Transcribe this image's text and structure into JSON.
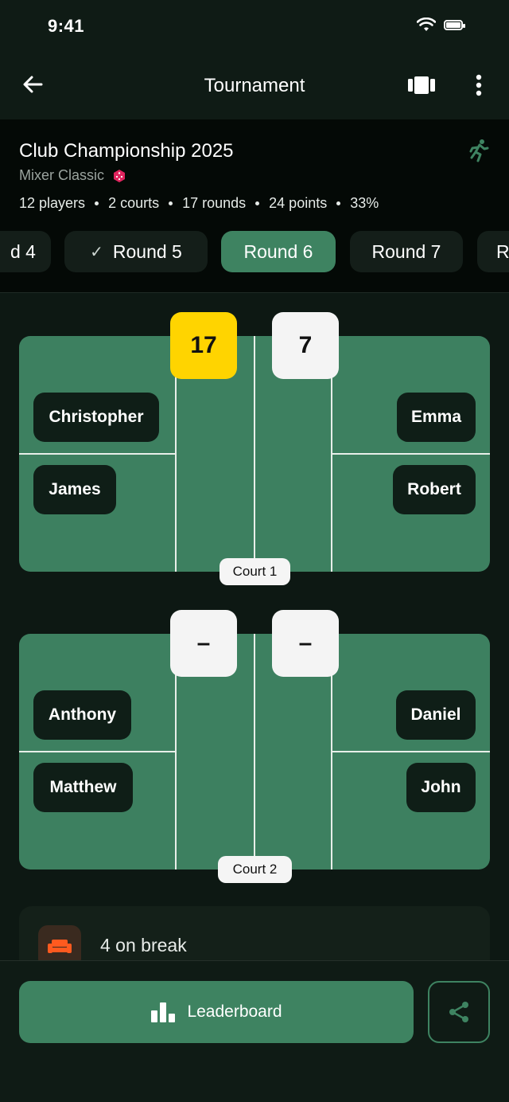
{
  "status": {
    "time": "9:41"
  },
  "nav": {
    "title": "Tournament"
  },
  "tournament": {
    "title": "Club Championship 2025",
    "format": "Mixer Classic",
    "stats": [
      "12 players",
      "2 courts",
      "17 rounds",
      "24 points",
      "33%"
    ]
  },
  "rounds": [
    {
      "label": "d 4",
      "state": "done"
    },
    {
      "label": "Round 5",
      "state": "done",
      "check": "✓"
    },
    {
      "label": "Round 6",
      "state": "active"
    },
    {
      "label": "Round 7",
      "state": "upcoming"
    },
    {
      "label": "R",
      "state": "upcoming"
    }
  ],
  "courts": [
    {
      "label": "Court 1",
      "score_left": "17",
      "score_right": "7",
      "left_players": [
        "Christopher",
        "James"
      ],
      "right_players": [
        "Emma",
        "Robert"
      ]
    },
    {
      "label": "Court 2",
      "score_left": "–",
      "score_right": "–",
      "left_players": [
        "Anthony",
        "Matthew"
      ],
      "right_players": [
        "Daniel",
        "John"
      ]
    }
  ],
  "break_info": {
    "text": "4 on break"
  },
  "actions": {
    "leaderboard": "Leaderboard"
  },
  "colors": {
    "accent": "#3e8361",
    "court": "#3d8060",
    "winner_score": "#ffd400",
    "background": "#0c1611"
  },
  "icons": [
    "back-arrow-icon",
    "cards-icon",
    "more-vertical-icon",
    "dice-icon",
    "running-icon",
    "check-icon",
    "sofa-icon",
    "bar-chart-icon",
    "share-icon",
    "wifi-icon",
    "battery-icon"
  ]
}
